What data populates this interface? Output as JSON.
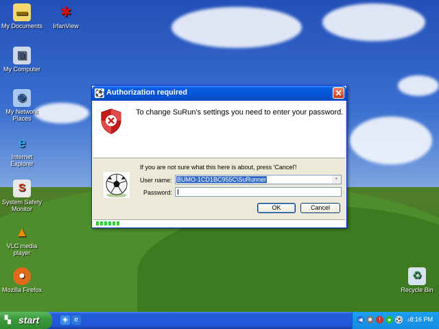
{
  "desktop": {
    "icons": [
      {
        "label": "My Documents"
      },
      {
        "label": "IrfanView"
      },
      {
        "label": "My Computer"
      },
      {
        "label": "My Network Places"
      },
      {
        "label": "Internet Explorer"
      },
      {
        "label": "System Safety Monitor"
      },
      {
        "label": "VLC media player"
      },
      {
        "label": "Mozilla Firefox"
      },
      {
        "label": "Recycle Bin"
      }
    ]
  },
  "dialog": {
    "title": "Authorization required",
    "close_glyph": "✕",
    "message": "To change SuRun's settings you need to enter your password.",
    "hint": "If you are not sure what this here is about, press 'Cancel'!",
    "username_label": "User name:",
    "username_value": "BUMO-1CD1BC955C\\SuRunner",
    "password_label": "Password:",
    "password_value": "",
    "ok_label": "OK",
    "cancel_label": "Cancel",
    "progress_segments": 6
  },
  "taskbar": {
    "start_label": "start",
    "clock": "8:16 PM"
  },
  "colors": {
    "titlebar": "#0654d8",
    "dialog_bg": "#ece9d8",
    "taskbar": "#245edc",
    "start_green": "#3c9a3c",
    "progress_green": "#2fd12f"
  }
}
